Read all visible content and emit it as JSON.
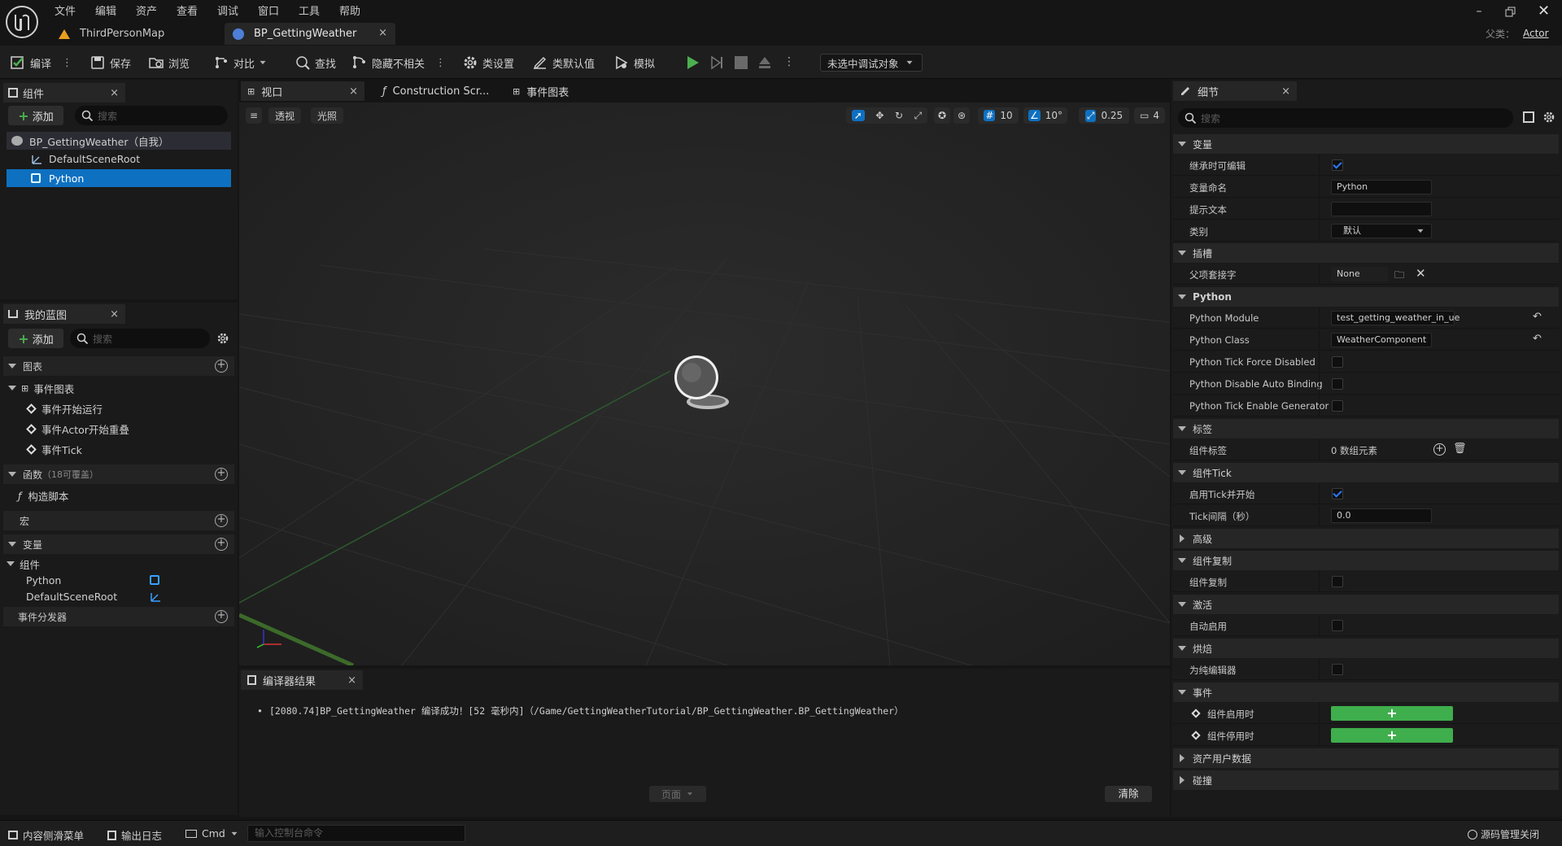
{
  "menu": [
    "文件",
    "编辑",
    "资产",
    "查看",
    "调试",
    "窗口",
    "工具",
    "帮助"
  ],
  "doc_tabs": [
    {
      "label": "ThirdPersonMap"
    },
    {
      "label": "BP_GettingWeather"
    }
  ],
  "parent_class": {
    "label": "父类：",
    "value": "Actor"
  },
  "toolbar": {
    "compile": "编译",
    "save": "保存",
    "browse": "浏览",
    "diff": "对比",
    "find": "查找",
    "hide_unrelated": "隐藏不相关",
    "class_settings": "类设置",
    "class_defaults": "类默认值",
    "simulate": "模拟",
    "debug_target": "未选中调试对象"
  },
  "components_panel": {
    "title": "组件",
    "add": "添加",
    "search_placeholder": "搜索",
    "items": [
      {
        "label": "BP_GettingWeather（自我）"
      },
      {
        "label": "DefaultSceneRoot"
      },
      {
        "label": "Python"
      }
    ]
  },
  "my_blueprint": {
    "title": "我的蓝图",
    "add": "添加",
    "search_placeholder": "搜索",
    "graphs_header": "图表",
    "event_graph": "事件图表",
    "events": [
      "事件开始运行",
      "事件Actor开始重叠",
      "事件Tick"
    ],
    "functions_header": "函数",
    "functions_count": "（18可覆盖）",
    "construction_script": "构造脚本",
    "macros_header": "宏",
    "variables_header": "变量",
    "components_group": "组件",
    "variables": [
      "Python",
      "DefaultSceneRoot"
    ],
    "dispatchers_header": "事件分发器"
  },
  "center_tabs": {
    "viewport": "视口",
    "construction": "Construction Scr...",
    "event_graph": "事件图表"
  },
  "viewport_toolbar": {
    "perspective": "透视",
    "lit": "光照",
    "grid_snap": "10",
    "rot_snap": "10°",
    "scale_snap": "0.25",
    "camera_speed": "4"
  },
  "compiler": {
    "title": "编译器结果",
    "message": "[2080.74]BP_GettingWeather 编译成功！[52 毫秒内]（/Game/GettingWeatherTutorial/BP_GettingWeather.BP_GettingWeather）",
    "page": "页面",
    "clear": "清除"
  },
  "details": {
    "title": "细节",
    "search_placeholder": "搜索",
    "sections": {
      "variables": "变量",
      "sockets": "插槽",
      "python": "Python",
      "tags": "标签",
      "component_tick": "组件Tick",
      "advanced": "高级",
      "replication": "组件复制",
      "activation": "激活",
      "cooking": "烘焙",
      "events": "事件",
      "asset_user_data": "资产用户数据",
      "collision": "碰撞"
    },
    "rows": {
      "editable_on_inherit": "继承时可编辑",
      "variable_name": "变量命名",
      "variable_name_value": "Python",
      "tooltip": "提示文本",
      "category": "类别",
      "category_value": "默认",
      "parent_socket": "父项套接字",
      "parent_socket_value": "None",
      "python_module": "Python Module",
      "python_module_value": "test_getting_weather_in_ue",
      "python_class": "Python Class",
      "python_class_value": "WeatherComponent",
      "tick_force_disabled": "Python Tick Force Disabled",
      "disable_auto_binding": "Python Disable Auto Binding",
      "tick_enable_generator": "Python Tick Enable Generator",
      "component_tags": "组件标签",
      "component_tags_value": "0 数组元素",
      "start_with_tick": "启用Tick并开始",
      "tick_interval": "Tick间隔（秒）",
      "tick_interval_value": "0.0",
      "component_replicates": "组件复制",
      "auto_activate": "自动启用",
      "editor_only": "为纯编辑器",
      "on_activated": "组件启用时",
      "on_deactivated": "组件停用时"
    }
  },
  "statusbar": {
    "content_drawer": "内容侧滑菜单",
    "output_log": "输出日志",
    "cmd": "Cmd",
    "console_placeholder": "输入控制台命令",
    "source_control": "源码管理关闭"
  },
  "colors": {
    "accent": "#0e70c0",
    "green": "#3fae4c",
    "play": "#4caf50"
  }
}
